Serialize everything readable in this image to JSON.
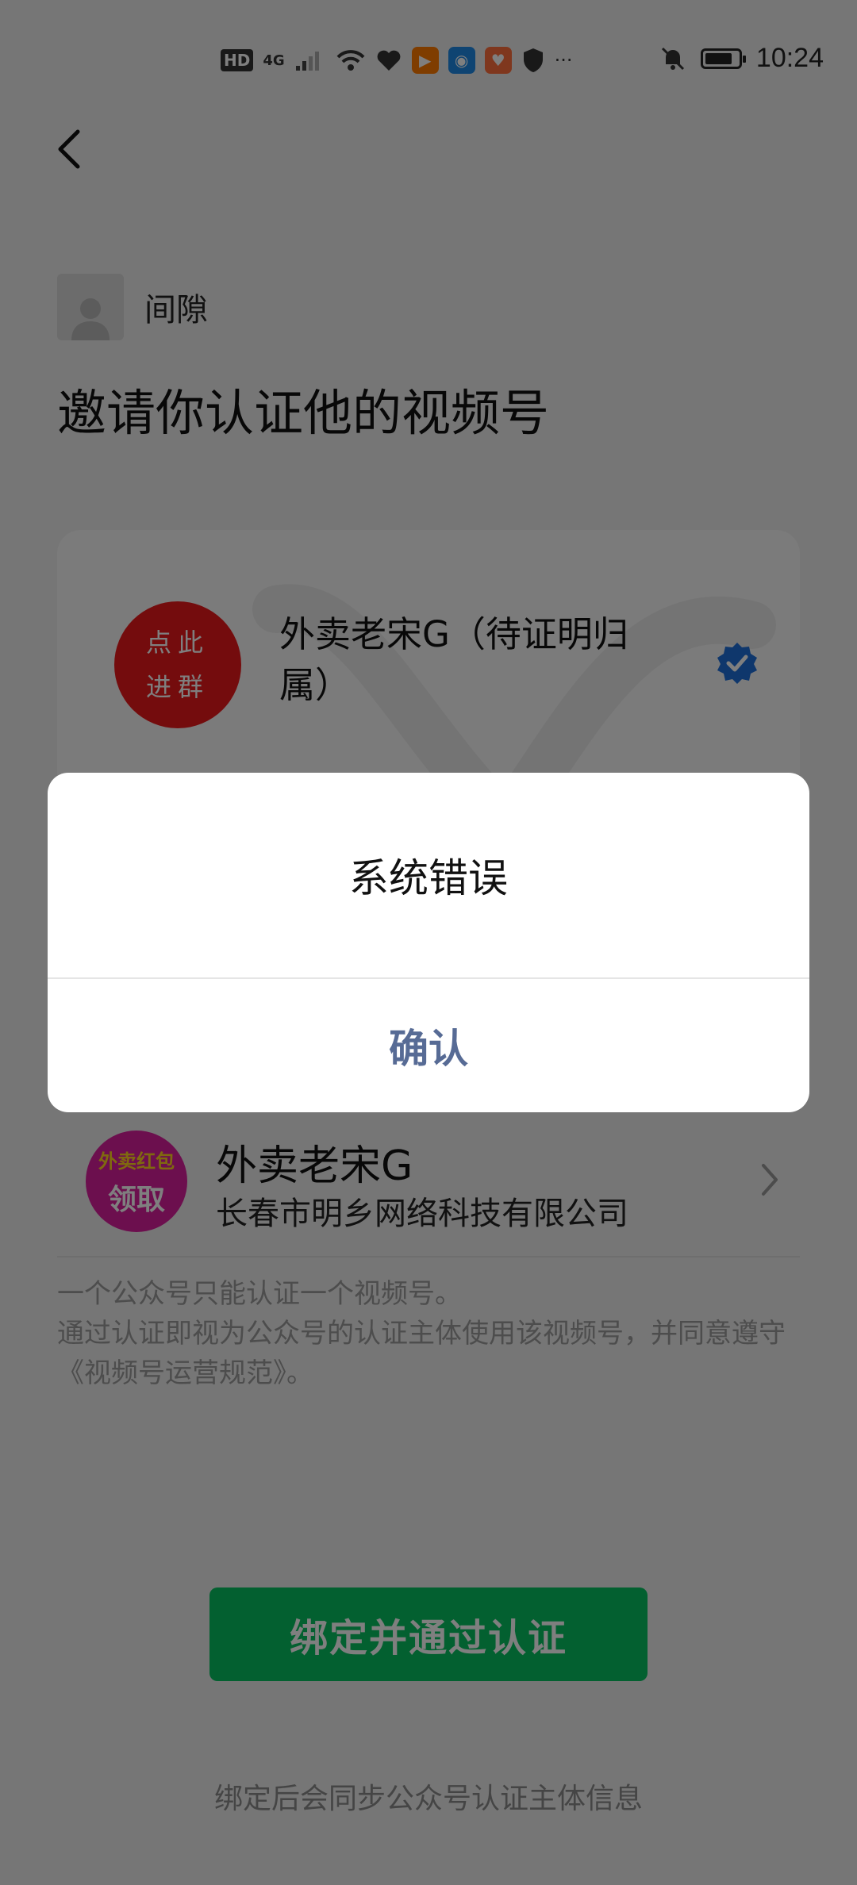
{
  "status_bar": {
    "hd": "HD",
    "network": "4G",
    "more": "···",
    "time": "10:24"
  },
  "header": {
    "inviter_name": "间隙",
    "headline": "邀请你认证他的视频号"
  },
  "channel_card": {
    "avatar_line1": "点此",
    "avatar_line2": "进群",
    "name": "外卖老宋G（待证明归属）"
  },
  "official_account": {
    "avatar_line1": "外卖红包",
    "avatar_line2": "领取",
    "name": "外卖老宋G",
    "company": "长春市明乡网络科技有限公司"
  },
  "notes": {
    "line1": "一个公众号只能认证一个视频号。",
    "line2": "通过认证即视为公众号的认证主体使用该视频号，并同意遵守《视频号运营规范》。"
  },
  "primary_button": "绑定并通过认证",
  "footer_note": "绑定后会同步公众号认证主体信息",
  "dialog": {
    "message": "系统错误",
    "confirm": "确认"
  },
  "colors": {
    "primary_green": "#07c160",
    "link_blue": "#576b95",
    "verified_blue": "#1e6fd9"
  }
}
